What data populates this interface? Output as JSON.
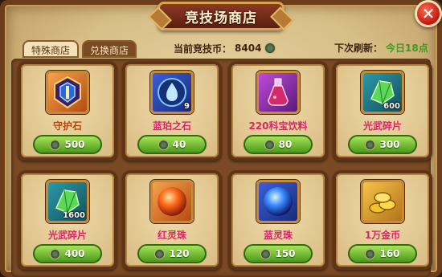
{
  "window": {
    "title": "竞技场商店",
    "close_label": "✕"
  },
  "tabs": [
    {
      "label": "特殊商店",
      "active": true
    },
    {
      "label": "兑换商店",
      "active": false
    }
  ],
  "currency": {
    "label": "当前竞技币：",
    "value": "8404",
    "icon": "arena-coin-icon"
  },
  "refresh": {
    "label": "下次刷新：",
    "value": "今日18点",
    "value_color": "#3d9a1a"
  },
  "items": [
    {
      "name": "守护石",
      "price": "500",
      "qty": "",
      "icon": "guardian-stone-icon",
      "name_color": "#b34a12"
    },
    {
      "name": "蓝珀之石",
      "price": "40",
      "qty": "9",
      "icon": "blue-amber-stone-icon",
      "name_color": "#d9266b"
    },
    {
      "name": "220科宝饮料",
      "price": "80",
      "qty": "",
      "icon": "potion-flask-icon",
      "name_color": "#d9266b"
    },
    {
      "name": "光武碎片",
      "price": "300",
      "qty": "600",
      "icon": "green-crystal-shard-icon",
      "name_color": "#d9266b"
    },
    {
      "name": "光武碎片",
      "price": "400",
      "qty": "1600",
      "icon": "green-crystal-shard-icon",
      "name_color": "#d9266b"
    },
    {
      "name": "红灵珠",
      "price": "120",
      "qty": "",
      "icon": "red-spirit-orb-icon",
      "name_color": "#d9266b"
    },
    {
      "name": "蓝灵珠",
      "price": "150",
      "qty": "",
      "icon": "blue-spirit-orb-icon",
      "name_color": "#d9266b"
    },
    {
      "name": "1万金币",
      "price": "160",
      "qty": "",
      "icon": "gold-coins-icon",
      "name_color": "#d9266b"
    }
  ]
}
